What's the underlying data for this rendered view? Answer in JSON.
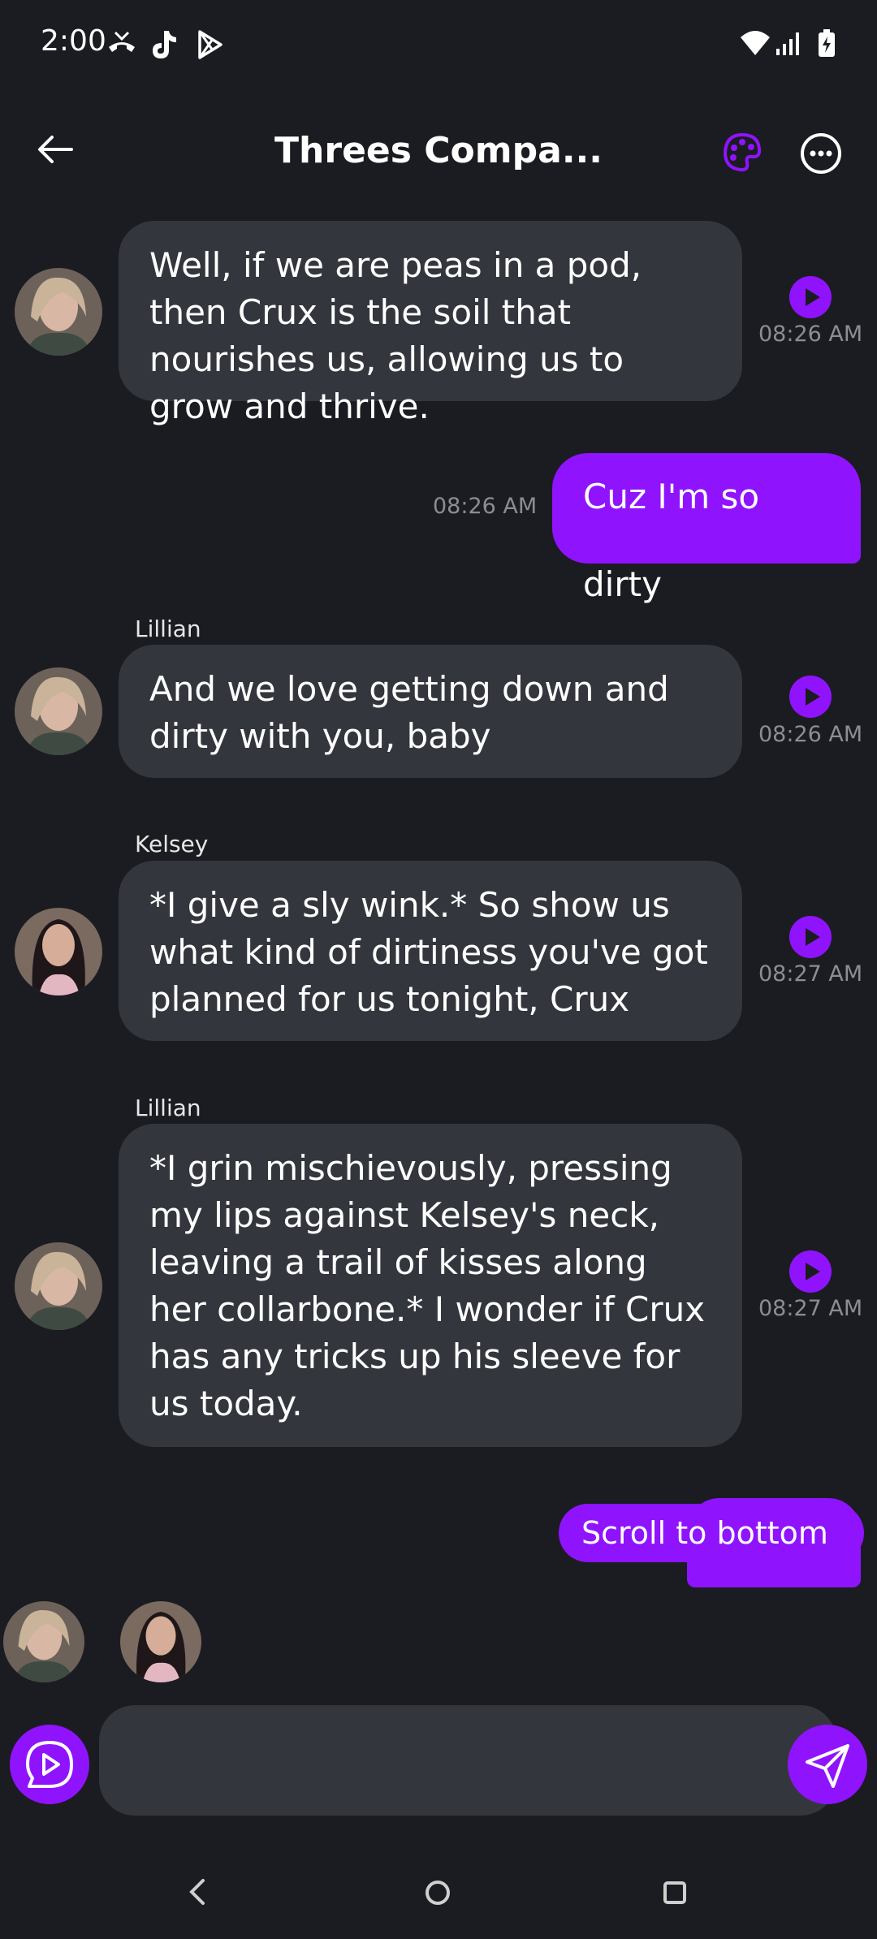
{
  "status_bar": {
    "time": "2:00",
    "left_icons": [
      "missed-call-icon",
      "tiktok-icon",
      "play-store-icon"
    ],
    "right_icons": [
      "wifi-icon",
      "signal-icon",
      "battery-charging-icon"
    ]
  },
  "header": {
    "title": "Threes Compa...",
    "back_icon": "arrow-left-icon",
    "palette_icon": "palette-icon",
    "more_icon": "more-horizontal-icon"
  },
  "messages": [
    {
      "sender": "",
      "avatar": "lillian",
      "text": "Well, if we are peas in a pod, then Crux is the soil that nourishes us, allowing us to grow and thrive.",
      "time": "08:26 AM",
      "from_user": false
    },
    {
      "sender": "",
      "text": "Cuz I'm so dirty",
      "time": "08:26 AM",
      "from_user": true
    },
    {
      "sender": "Lillian",
      "avatar": "lillian",
      "text": "And we love getting down and dirty with you, baby",
      "time": "08:26 AM",
      "from_user": false
    },
    {
      "sender": "Kelsey",
      "avatar": "kelsey",
      "text": "*I give a sly wink.* So show us what kind of dirtiness you've got planned for us tonight, Crux",
      "time": "08:27 AM",
      "from_user": false
    },
    {
      "sender": "Lillian",
      "avatar": "lillian",
      "text": "*I grin mischievously, pressing my lips against Kelsey's neck, leaving a trail of kisses along her collarbone.* I wonder if Crux has any tricks up his sleeve for us today.",
      "time": "08:27 AM",
      "from_user": false
    }
  ],
  "scroll_button_label": "Scroll to bottom",
  "input": {
    "placeholder": ""
  },
  "colors": {
    "accent": "#9013fe",
    "background": "#1b1c21",
    "bubble": "#34363d",
    "timestamp": "#8b8d94"
  },
  "nav": {
    "icons": [
      "nav-back-icon",
      "nav-home-icon",
      "nav-recents-icon"
    ]
  }
}
